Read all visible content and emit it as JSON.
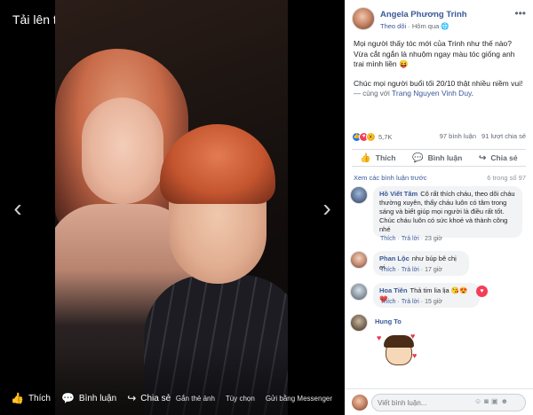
{
  "viewer": {
    "title": "Tải lên từ di động",
    "prev_icon": "chevron-left-icon",
    "next_icon": "chevron-right-icon",
    "actions": [
      {
        "label": "Thích",
        "icon": "like-icon"
      },
      {
        "label": "Bình luận",
        "icon": "comment-icon"
      },
      {
        "label": "Chia sẻ",
        "icon": "share-icon"
      }
    ],
    "links": [
      "Gắn thẻ ảnh",
      "Tùy chọn",
      "Gửi bằng Messenger"
    ]
  },
  "post": {
    "author": "Angela Phương Trinh",
    "follow": "Theo dõi",
    "time": "Hôm qua",
    "caption_line1": "Mọi người thấy tóc mới của Trinh như thế nào? Vừa cắt ngắn là nhuộm ngay màu tóc giống anh trai mình liền 😝",
    "caption_line2": "Chúc mọi người buổi tối 20/10 thật nhiều niềm vui!",
    "with_prefix": "— cùng với ",
    "with_name": "Trang Nguyen Vinh Duy",
    "with_suffix": ".",
    "reaction_count": "5,7K",
    "comment_count": "97 bình luận",
    "share_count": "91 lượt chia sẻ",
    "actions": [
      "Thích",
      "Bình luận",
      "Chia sẻ"
    ],
    "view_previous": "Xem các bình luận trước",
    "comment_progress": "6 trong số 97"
  },
  "comments": [
    {
      "author": "Hồ Viết Tâm",
      "text": "Cô rất thích cháu, theo dõi cháu thường xuyên, thấy cháu luôn có tâm trong sáng và biết giúp mọi người là điều rất tốt. Chúc cháu luôn có sức khoẻ và thành công nhé",
      "like": "Thích",
      "reply": "Trả lời",
      "time": "23 giờ"
    },
    {
      "author": "Phan Lộc",
      "text": "như búp bê chị ơi",
      "like": "Thích",
      "reply": "Trả lời",
      "time": "17 giờ"
    },
    {
      "author": "Hoa Tiên",
      "text": "Thả tim lia lịa 😘😍❤️",
      "like": "Thích",
      "reply": "Trả lời",
      "time": "15 giờ"
    },
    {
      "author": "Hung To",
      "text": "",
      "like": "",
      "reply": "",
      "time": ""
    }
  ],
  "composer": {
    "placeholder": "Viết bình luận...",
    "icons": [
      "emoji-icon",
      "camera-icon",
      "gif-icon",
      "sticker-icon"
    ]
  },
  "colors": {
    "link": "#385898",
    "like_reaction": "#1877f2",
    "love_reaction": "#f33e58",
    "wow_reaction": "#f7b125"
  }
}
